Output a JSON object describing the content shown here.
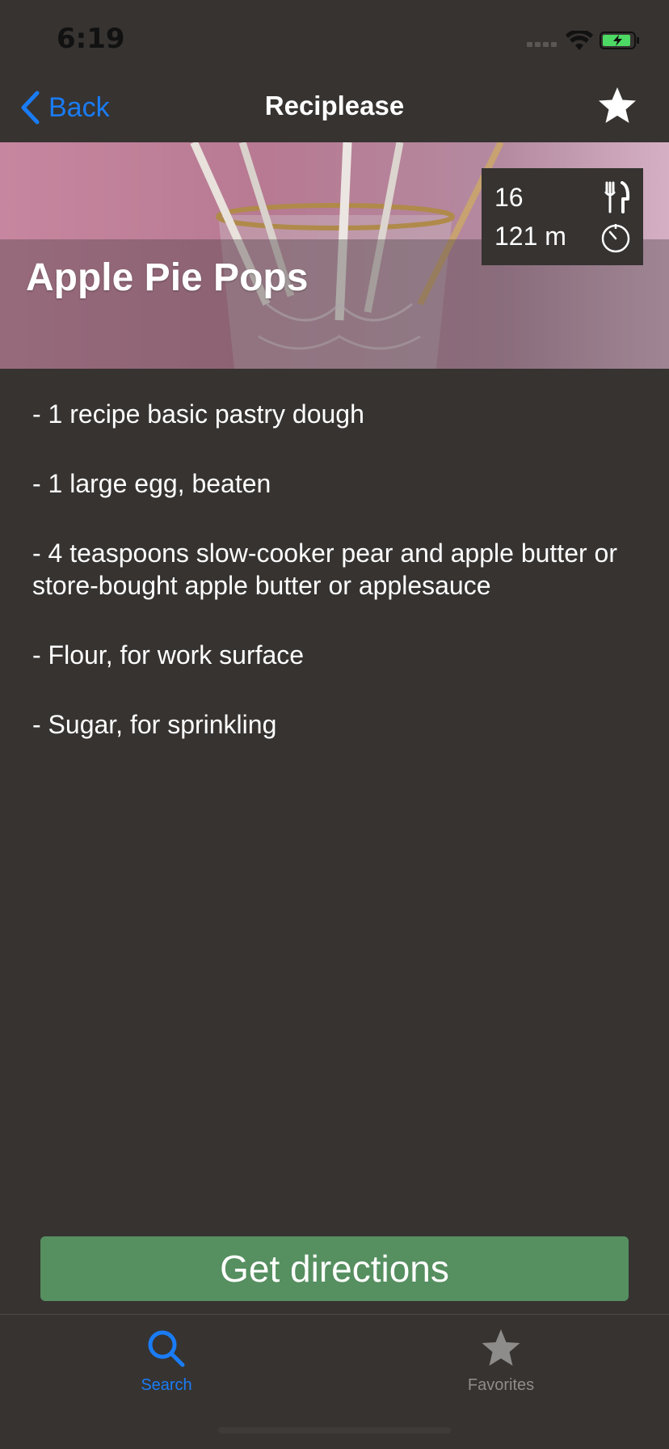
{
  "status_bar": {
    "time": "6:19"
  },
  "nav": {
    "back_label": "Back",
    "title": "Reciplease",
    "accent": "#1a7cf5",
    "star_icon": "star-icon"
  },
  "recipe": {
    "title": "Apple Pie Pops",
    "servings": "16",
    "time": "121 m",
    "ingredients": [
      "- 1 recipe basic pastry dough",
      "- 1 large egg, beaten",
      "- 4 teaspoons slow-cooker pear and apple butter or store-bought apple butter or applesauce",
      "- Flour, for work surface",
      "- Sugar, for sprinkling"
    ]
  },
  "actions": {
    "directions_label": "Get directions",
    "directions_color": "#568f60"
  },
  "tab_bar": {
    "items": [
      {
        "label": "Search",
        "icon": "search-icon",
        "color": "#1a7cf5",
        "selected": true
      },
      {
        "label": "Favorites",
        "icon": "star-icon",
        "color": "#8e8c8a",
        "selected": false
      }
    ]
  }
}
